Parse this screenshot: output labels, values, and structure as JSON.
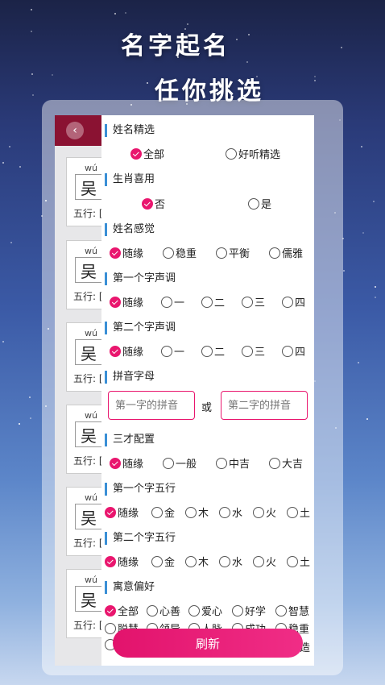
{
  "slogan": {
    "line1": "名字起名",
    "line2": "任你挑选"
  },
  "underlay": {
    "cards": [
      {
        "pinyin": "wú",
        "char": "吴",
        "wuxing": "五行: ["
      },
      {
        "pinyin": "wú",
        "char": "吴",
        "wuxing": "五行: ["
      },
      {
        "pinyin": "wú",
        "char": "吴",
        "wuxing": "五行: ["
      },
      {
        "pinyin": "wú",
        "char": "吴",
        "wuxing": "五行: ["
      },
      {
        "pinyin": "wú",
        "char": "吴",
        "wuxing": "五行: ["
      },
      {
        "pinyin": "wú",
        "char": "吴",
        "wuxing": "五行: ["
      }
    ]
  },
  "filters": {
    "name_selection": {
      "title": "姓名精选",
      "options": [
        "全部",
        "好听精选"
      ],
      "selected": 0
    },
    "zodiac": {
      "title": "生肖喜用",
      "options": [
        "否",
        "是"
      ],
      "selected": 0
    },
    "feeling": {
      "title": "姓名感觉",
      "options": [
        "随缘",
        "稳重",
        "平衡",
        "儒雅"
      ],
      "selected": 0
    },
    "tone1": {
      "title": "第一个字声调",
      "options": [
        "随缘",
        "一",
        "二",
        "三",
        "四"
      ],
      "selected": 0
    },
    "tone2": {
      "title": "第二个字声调",
      "options": [
        "随缘",
        "一",
        "二",
        "三",
        "四"
      ],
      "selected": 0
    },
    "pinyin": {
      "title": "拼音字母",
      "first_placeholder": "第一字的拼音",
      "or": "或",
      "second_placeholder": "第二字的拼音"
    },
    "sancai": {
      "title": "三才配置",
      "options": [
        "随缘",
        "一般",
        "中吉",
        "大吉"
      ],
      "selected": 0
    },
    "wuxing1": {
      "title": "第一个字五行",
      "options": [
        "随缘",
        "金",
        "木",
        "水",
        "火",
        "土"
      ],
      "selected": 0
    },
    "wuxing2": {
      "title": "第二个字五行",
      "options": [
        "随缘",
        "金",
        "木",
        "水",
        "火",
        "土"
      ],
      "selected": 0
    },
    "meaning": {
      "title": "寓意偏好",
      "row1": [
        "全部",
        "心善",
        "爱心",
        "好学",
        "智慧"
      ],
      "row2": [
        "聪慧",
        "领导",
        "人脉",
        "成功",
        "稳重"
      ],
      "row3_last": "造",
      "selected": 0
    }
  },
  "refresh_label": "刷新",
  "colors": {
    "accent": "#e9166e",
    "section_bar": "#3a8fd6",
    "header": "#8a1232"
  }
}
